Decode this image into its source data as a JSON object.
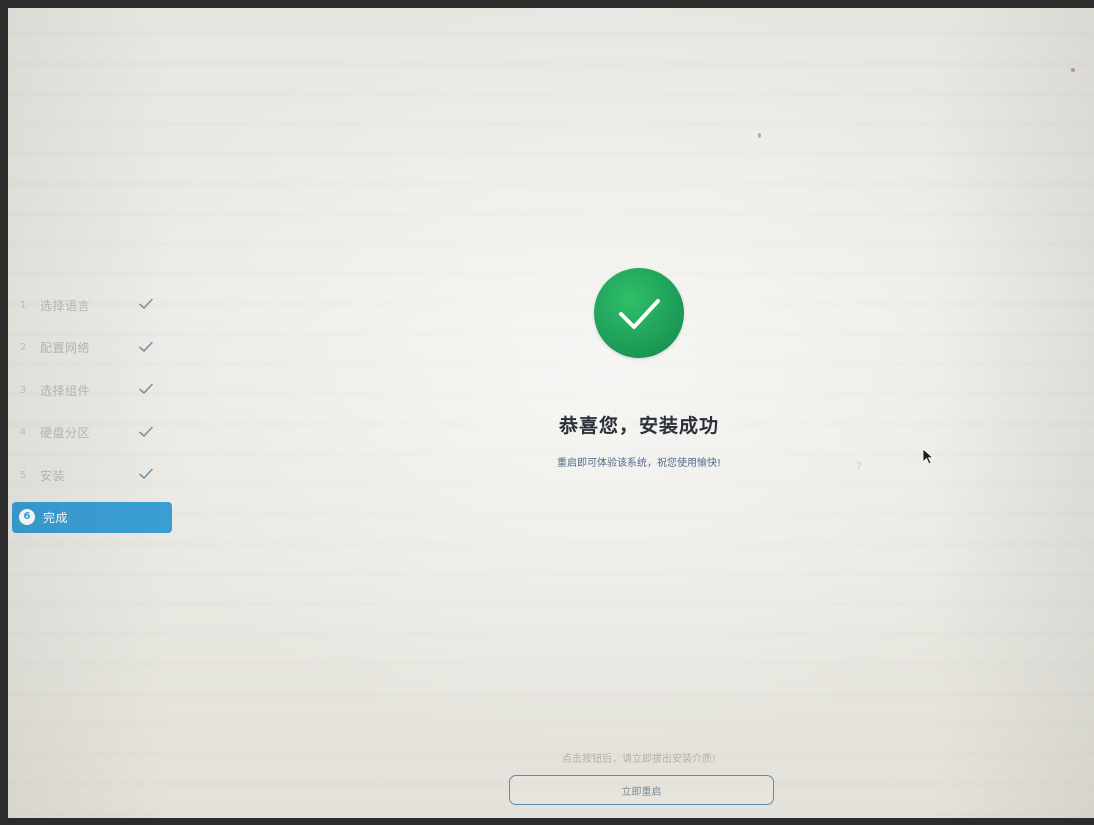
{
  "steps": [
    {
      "number": "1",
      "label": "选择语言",
      "status": "done"
    },
    {
      "number": "2",
      "label": "配置网络",
      "status": "done"
    },
    {
      "number": "3",
      "label": "选择组件",
      "status": "done"
    },
    {
      "number": "4",
      "label": "硬盘分区",
      "status": "done"
    },
    {
      "number": "5",
      "label": "安装",
      "status": "done"
    },
    {
      "number": "6",
      "label": "完成",
      "status": "active"
    }
  ],
  "main": {
    "icon": "success-check-icon",
    "title": "恭喜您，安装成功",
    "subtitle": "重启即可体验该系统，祝您使用愉快!",
    "hint": "点击按钮后，请立即拔出安装介质!",
    "restart_label": "立即重启"
  },
  "colors": {
    "accent": "#3a9ed3",
    "success": "#1fa15a",
    "check": "#6f8fa8"
  }
}
